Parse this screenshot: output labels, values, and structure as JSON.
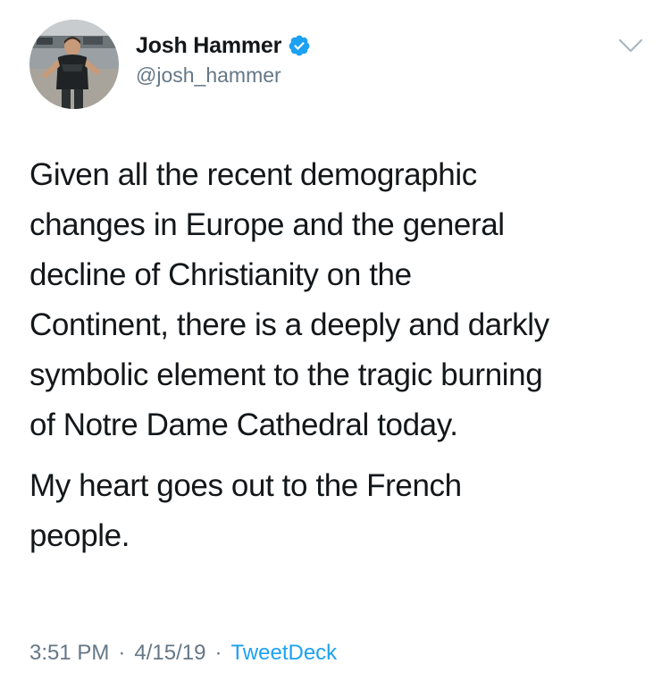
{
  "tweet": {
    "author": {
      "display_name": "Josh Hammer",
      "handle": "@josh_hammer",
      "verified": true
    },
    "text": {
      "paragraph_1": "Given all the recent demographic\nchanges in Europe and the general\ndecline of Christianity on the\nContinent, there is a deeply and darkly\nsymbolic element to the tragic burning\nof Notre Dame Cathedral today.",
      "paragraph_2": "My heart goes out to the French\npeople."
    },
    "meta": {
      "time": "3:51 PM",
      "separator": "·",
      "date": "4/15/19",
      "source": "TweetDeck"
    }
  },
  "icons": {
    "verified": "verified-badge-icon",
    "menu": "chevron-down-icon"
  },
  "colors": {
    "text_primary": "#14171a",
    "text_secondary": "#657786",
    "link_blue": "#1da1f2",
    "background": "#ffffff"
  }
}
